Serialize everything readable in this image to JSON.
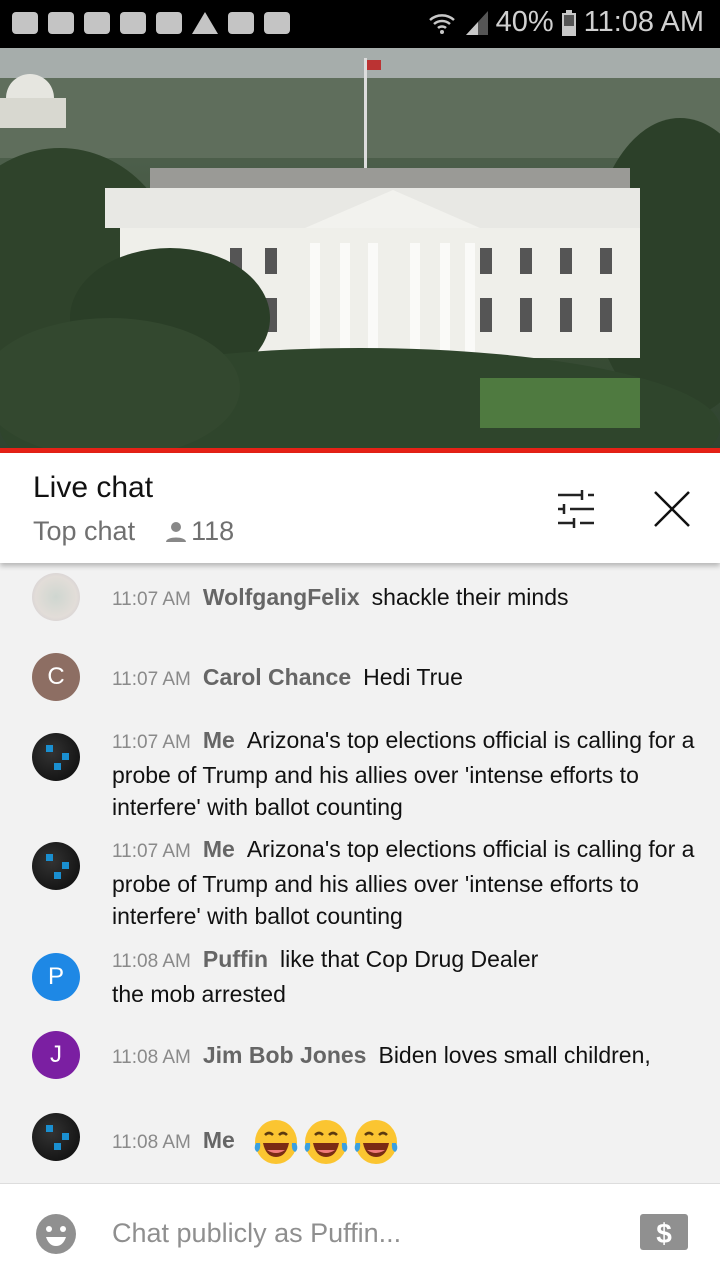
{
  "status_bar": {
    "battery": "40%",
    "time": "11:08 AM",
    "notification_icons": [
      "chat-icon",
      "play-icon",
      "play-icon",
      "play-icon",
      "folder-icon",
      "warning-icon",
      "image-icon",
      "calendar-icon"
    ]
  },
  "video": {
    "scene": "white-house-livestream"
  },
  "header": {
    "title": "Live chat",
    "mode": "Top chat",
    "viewers": "118"
  },
  "messages": [
    {
      "time": "11:07 AM",
      "author": "WolfgangFelix",
      "text": "shackle their minds",
      "avatar": "image"
    },
    {
      "time": "11:07 AM",
      "author": "Carol Chance",
      "text": "Hedi True",
      "avatar": "C",
      "color": "#8d6e63"
    },
    {
      "time": "11:07 AM",
      "author": "Me",
      "text": "Arizona's top elections official is calling for a probe of Trump and his allies over 'intense efforts to interfere' with ballot counting",
      "avatar": "dark"
    },
    {
      "time": "11:07 AM",
      "author": "Me",
      "text": "Arizona's top elections official is calling for a probe of Trump and his allies over 'intense efforts to interfere' with ballot counting",
      "avatar": "dark"
    },
    {
      "time": "11:08 AM",
      "author": "Puffin",
      "text": "like that Cop Drug Dealer the mob arrested",
      "avatar": "P",
      "color": "#1e88e5"
    },
    {
      "time": "11:08 AM",
      "author": "Jim Bob Jones",
      "text": "Biden loves small children,",
      "avatar": "J",
      "color": "#7b1fa2"
    },
    {
      "time": "11:08 AM",
      "author": "Me",
      "text": "😂😂😂",
      "avatar": "dark"
    }
  ],
  "input": {
    "placeholder": "Chat publicly as Puffin..."
  },
  "colors": {
    "accent": "#e62117",
    "background": "#f2f2f2"
  }
}
